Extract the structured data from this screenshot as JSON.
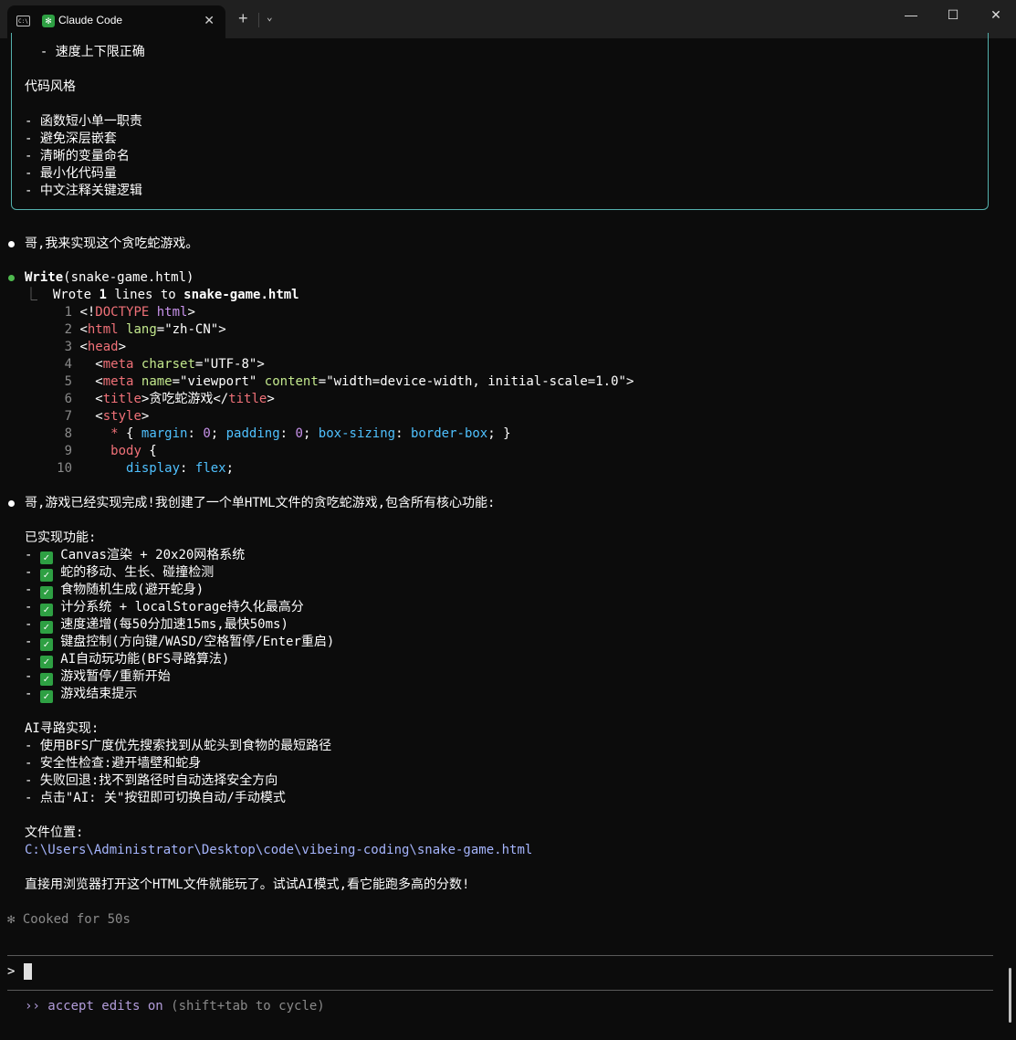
{
  "window": {
    "tab_title": "Claude Code",
    "terminal_icon_text": "C:\\",
    "claude_icon": "✻",
    "close_glyph": "✕",
    "new_tab_glyph": "+",
    "dropdown_glyph": "⌄",
    "minimize_glyph": "—",
    "maximize_glyph": "☐",
    "window_close_glyph": "✕"
  },
  "box": {
    "lines": [
      "  - 速度上下限正确",
      "",
      "代码风格",
      "",
      "- 函数短小单一职责",
      "- 避免深层嵌套",
      "- 清晰的变量命名",
      "- 最小化代码量",
      "- 中文注释关键逻辑"
    ]
  },
  "message1": "哥,我来实现这个贪吃蛇游戏。",
  "tool": {
    "name": "Write",
    "arg": "(snake-game.html)",
    "result_prefix": "⎿",
    "result": "Wrote ",
    "result_count": "1",
    "result_suffix": " lines to ",
    "result_file": "snake-game.html"
  },
  "code": {
    "line_numbers": [
      "1",
      "2",
      "3",
      "4",
      "5",
      "6",
      "7",
      "8",
      "9",
      "10"
    ],
    "l1": [
      "<!",
      "DOCTYPE",
      " ",
      "html",
      ">"
    ],
    "l2": [
      "<",
      "html",
      " ",
      "lang",
      "=",
      "\"zh-CN\"",
      ">"
    ],
    "l3": [
      "<",
      "head",
      ">"
    ],
    "l4": [
      "  <",
      "meta",
      " ",
      "charset",
      "=",
      "\"UTF-8\"",
      ">"
    ],
    "l5": [
      "  <",
      "meta",
      " ",
      "name",
      "=",
      "\"viewport\"",
      " ",
      "content",
      "=",
      "\"width=device-width, initial-scale=1.0\"",
      ">"
    ],
    "l6": [
      "  <",
      "title",
      ">",
      "贪吃蛇游戏",
      "</",
      "title",
      ">"
    ],
    "l7": [
      "  <",
      "style",
      ">"
    ],
    "l8": [
      "    ",
      "*",
      " { ",
      "margin",
      ": ",
      "0",
      "; ",
      "padding",
      ": ",
      "0",
      "; ",
      "box-sizing",
      ": ",
      "border-box",
      "; }"
    ],
    "l9": [
      "    ",
      "body",
      " {"
    ],
    "l10": [
      "      ",
      "display",
      ": ",
      "flex",
      ";"
    ]
  },
  "summary": {
    "intro": "哥,游戏已经实现完成!我创建了一个单HTML文件的贪吃蛇游戏,包含所有核心功能:",
    "features_title": "已实现功能:",
    "check_glyph": "✓",
    "features": [
      "Canvas渲染 + 20x20网格系统",
      "蛇的移动、生长、碰撞检测",
      "食物随机生成(避开蛇身)",
      "计分系统 + localStorage持久化最高分",
      "速度递增(每50分加速15ms,最快50ms)",
      "键盘控制(方向键/WASD/空格暂停/Enter重启)",
      "AI自动玩功能(BFS寻路算法)",
      "游戏暂停/重新开始",
      "游戏结束提示"
    ],
    "ai_title": "AI寻路实现:",
    "ai_items": [
      "- 使用BFS广度优先搜索找到从蛇头到食物的最短路径",
      "- 安全性检查:避开墙壁和蛇身",
      "- 失败回退:找不到路径时自动选择安全方向",
      "- 点击\"AI: 关\"按钮即可切换自动/手动模式"
    ],
    "location_title": "文件位置:",
    "location_path": "C:\\Users\\Administrator\\Desktop\\code\\vibeing-coding\\snake-game.html",
    "closing": "直接用浏览器打开这个HTML文件就能玩了。试试AI模式,看它能跑多高的分数!"
  },
  "status": {
    "glyph": "✻",
    "text": "Cooked for 50s"
  },
  "prompt": {
    "symbol": ">",
    "value": ""
  },
  "footer": {
    "arrows": "››",
    "mode": "accept edits on",
    "hint": " (shift+tab to cycle)"
  }
}
